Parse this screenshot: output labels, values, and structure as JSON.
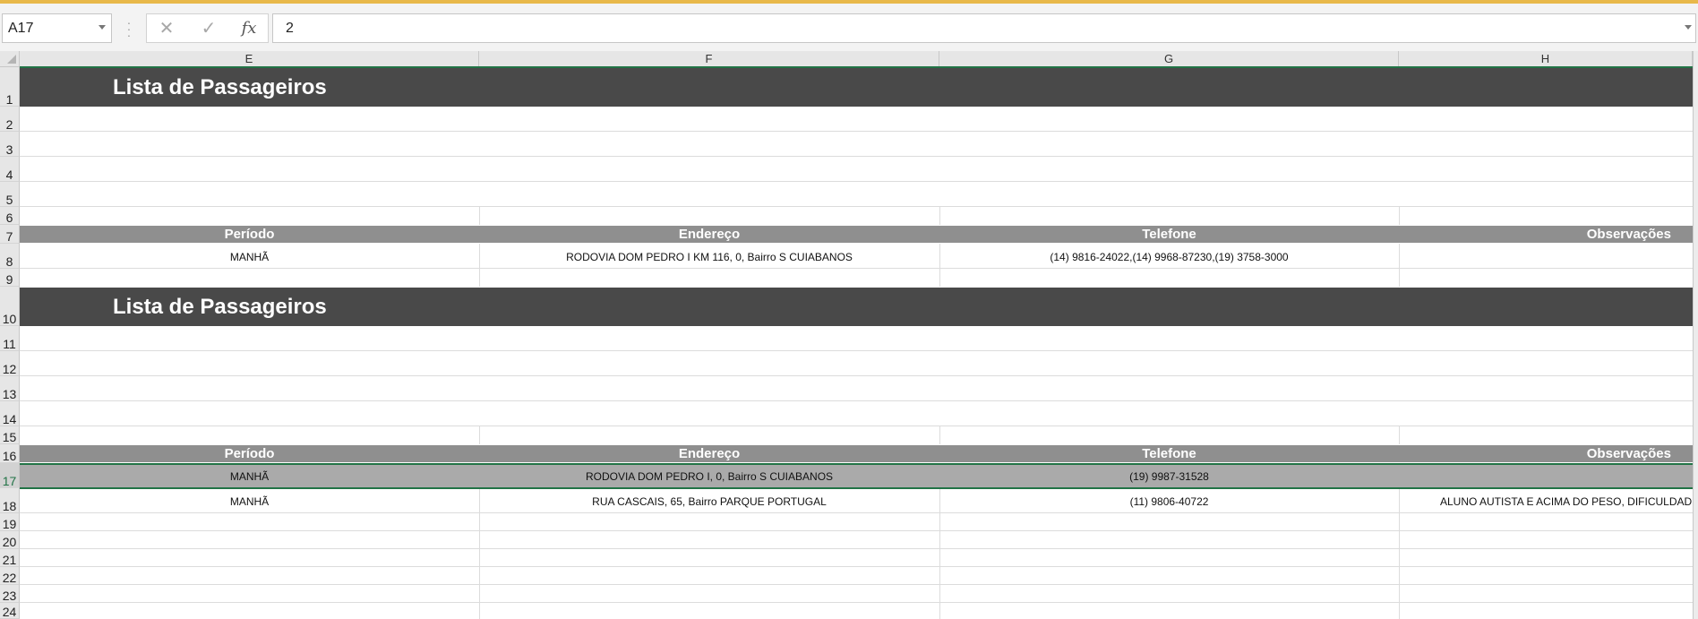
{
  "formula_bar": {
    "name_box": "A17",
    "cancel_icon": "close-icon",
    "enter_icon": "check-icon",
    "fx_label": "fx",
    "formula_value": "2"
  },
  "columns": [
    "E",
    "F",
    "G",
    "H"
  ],
  "rows": [
    "1",
    "2",
    "3",
    "4",
    "5",
    "6",
    "7",
    "8",
    "9",
    "10",
    "11",
    "12",
    "13",
    "14",
    "15",
    "16",
    "17",
    "18",
    "19",
    "20",
    "21",
    "22",
    "23",
    "24"
  ],
  "selected_row": "17",
  "section1": {
    "title": "Lista de Passageiros",
    "headers": [
      "Período",
      "Endereço",
      "Telefone",
      "Observações"
    ],
    "records": [
      {
        "periodo": "MANHÃ",
        "endereco": "RODOVIA DOM PEDRO I KM 116, 0, Bairro S CUIABANOS",
        "telefone": "(14) 9816-24022,(14) 9968-87230,(19) 3758-3000",
        "obs": ""
      }
    ]
  },
  "section2": {
    "title": "Lista de Passageiros",
    "headers": [
      "Período",
      "Endereço",
      "Telefone",
      "Observações"
    ],
    "records": [
      {
        "periodo": "MANHÃ",
        "endereco": "RODOVIA DOM PEDRO I, 0, Bairro S CUIABANOS",
        "telefone": "(19) 9987-31528",
        "obs": ""
      },
      {
        "periodo": "MANHÃ",
        "endereco": "RUA CASCAIS, 65, Bairro PARQUE PORTUGAL",
        "telefone": "(11) 9806-40722",
        "obs": "ALUNO AUTISTA E ACIMA DO PESO, DIFICULDADE"
      }
    ]
  }
}
